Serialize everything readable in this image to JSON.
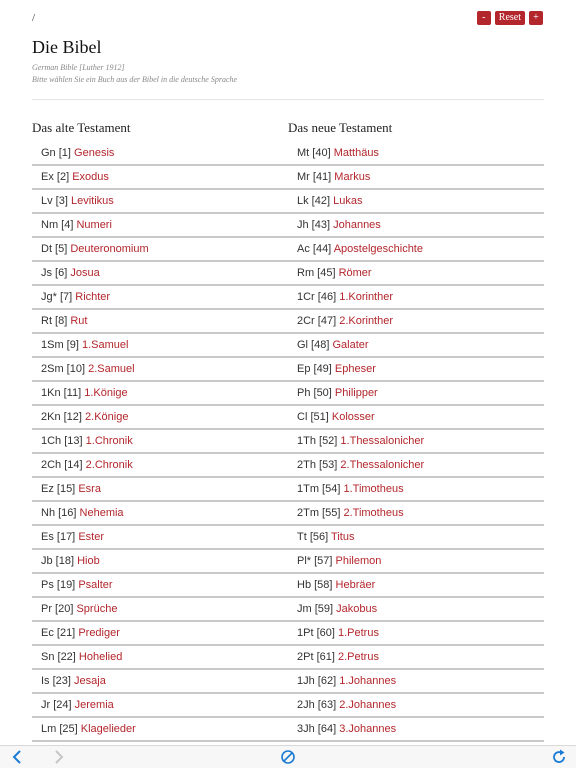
{
  "breadcrumb": "/",
  "zoom": {
    "minus": "-",
    "reset": "Reset",
    "plus": "+"
  },
  "title": "Die Bibel",
  "subtitle": "German Bible [Luther 1912]",
  "instruction": "Bitte wählen Sie ein Buch aus der Bibel in die deutsche Sprache",
  "old_testament": {
    "heading": "Das alte Testament",
    "books": [
      {
        "abbr": "Gn [1]",
        "name": "Genesis"
      },
      {
        "abbr": "Ex [2]",
        "name": "Exodus"
      },
      {
        "abbr": "Lv [3]",
        "name": "Levitikus"
      },
      {
        "abbr": "Nm [4]",
        "name": "Numeri"
      },
      {
        "abbr": "Dt [5]",
        "name": "Deuteronomium"
      },
      {
        "abbr": "Js [6]",
        "name": "Josua"
      },
      {
        "abbr": "Jg* [7]",
        "name": "Richter"
      },
      {
        "abbr": "Rt [8]",
        "name": "Rut"
      },
      {
        "abbr": "1Sm [9]",
        "name": "1.Samuel"
      },
      {
        "abbr": "2Sm [10]",
        "name": "2.Samuel"
      },
      {
        "abbr": "1Kn [11]",
        "name": "1.Könige"
      },
      {
        "abbr": "2Kn [12]",
        "name": "2.Könige"
      },
      {
        "abbr": "1Ch [13]",
        "name": "1.Chronik"
      },
      {
        "abbr": "2Ch [14]",
        "name": "2.Chronik"
      },
      {
        "abbr": "Ez [15]",
        "name": "Esra"
      },
      {
        "abbr": "Nh [16]",
        "name": "Nehemia"
      },
      {
        "abbr": "Es [17]",
        "name": "Ester"
      },
      {
        "abbr": "Jb [18]",
        "name": "Hiob"
      },
      {
        "abbr": "Ps [19]",
        "name": "Psalter"
      },
      {
        "abbr": "Pr [20]",
        "name": "Sprüche"
      },
      {
        "abbr": "Ec [21]",
        "name": "Prediger"
      },
      {
        "abbr": "Sn [22]",
        "name": "Hohelied"
      },
      {
        "abbr": "Is [23]",
        "name": "Jesaja"
      },
      {
        "abbr": "Jr [24]",
        "name": "Jeremia"
      },
      {
        "abbr": "Lm [25]",
        "name": "Klagelieder"
      }
    ]
  },
  "new_testament": {
    "heading": "Das neue Testament",
    "books": [
      {
        "abbr": "Mt [40]",
        "name": "Matthäus"
      },
      {
        "abbr": "Mr [41]",
        "name": "Markus"
      },
      {
        "abbr": "Lk [42]",
        "name": "Lukas"
      },
      {
        "abbr": "Jh [43]",
        "name": "Johannes"
      },
      {
        "abbr": "Ac [44]",
        "name": "Apostelgeschichte"
      },
      {
        "abbr": "Rm [45]",
        "name": "Römer"
      },
      {
        "abbr": "1Cr [46]",
        "name": "1.Korinther"
      },
      {
        "abbr": "2Cr [47]",
        "name": "2.Korinther"
      },
      {
        "abbr": "Gl [48]",
        "name": "Galater"
      },
      {
        "abbr": "Ep [49]",
        "name": "Epheser"
      },
      {
        "abbr": "Ph [50]",
        "name": "Philipper"
      },
      {
        "abbr": "Cl [51]",
        "name": "Kolosser"
      },
      {
        "abbr": "1Th [52]",
        "name": "1.Thessalonicher"
      },
      {
        "abbr": "2Th [53]",
        "name": "2.Thessalonicher"
      },
      {
        "abbr": "1Tm [54]",
        "name": "1.Timotheus"
      },
      {
        "abbr": "2Tm [55]",
        "name": "2.Timotheus"
      },
      {
        "abbr": "Tt [56]",
        "name": "Titus"
      },
      {
        "abbr": "Pl* [57]",
        "name": "Philemon"
      },
      {
        "abbr": "Hb [58]",
        "name": "Hebräer"
      },
      {
        "abbr": "Jm [59]",
        "name": "Jakobus"
      },
      {
        "abbr": "1Pt [60]",
        "name": "1.Petrus"
      },
      {
        "abbr": "2Pt [61]",
        "name": "2.Petrus"
      },
      {
        "abbr": "1Jh [62]",
        "name": "1.Johannes"
      },
      {
        "abbr": "2Jh [63]",
        "name": "2.Johannes"
      },
      {
        "abbr": "3Jh [64]",
        "name": "3.Johannes"
      }
    ]
  },
  "toolbar": {
    "back": "chevron-left-icon",
    "forward": "chevron-right-icon",
    "stop": "stop-icon",
    "reload": "reload-icon"
  },
  "colors": {
    "accent": "#b3262c",
    "toolbar_icon": "#1a7bd4",
    "toolbar_disabled": "#c6c6c6"
  }
}
